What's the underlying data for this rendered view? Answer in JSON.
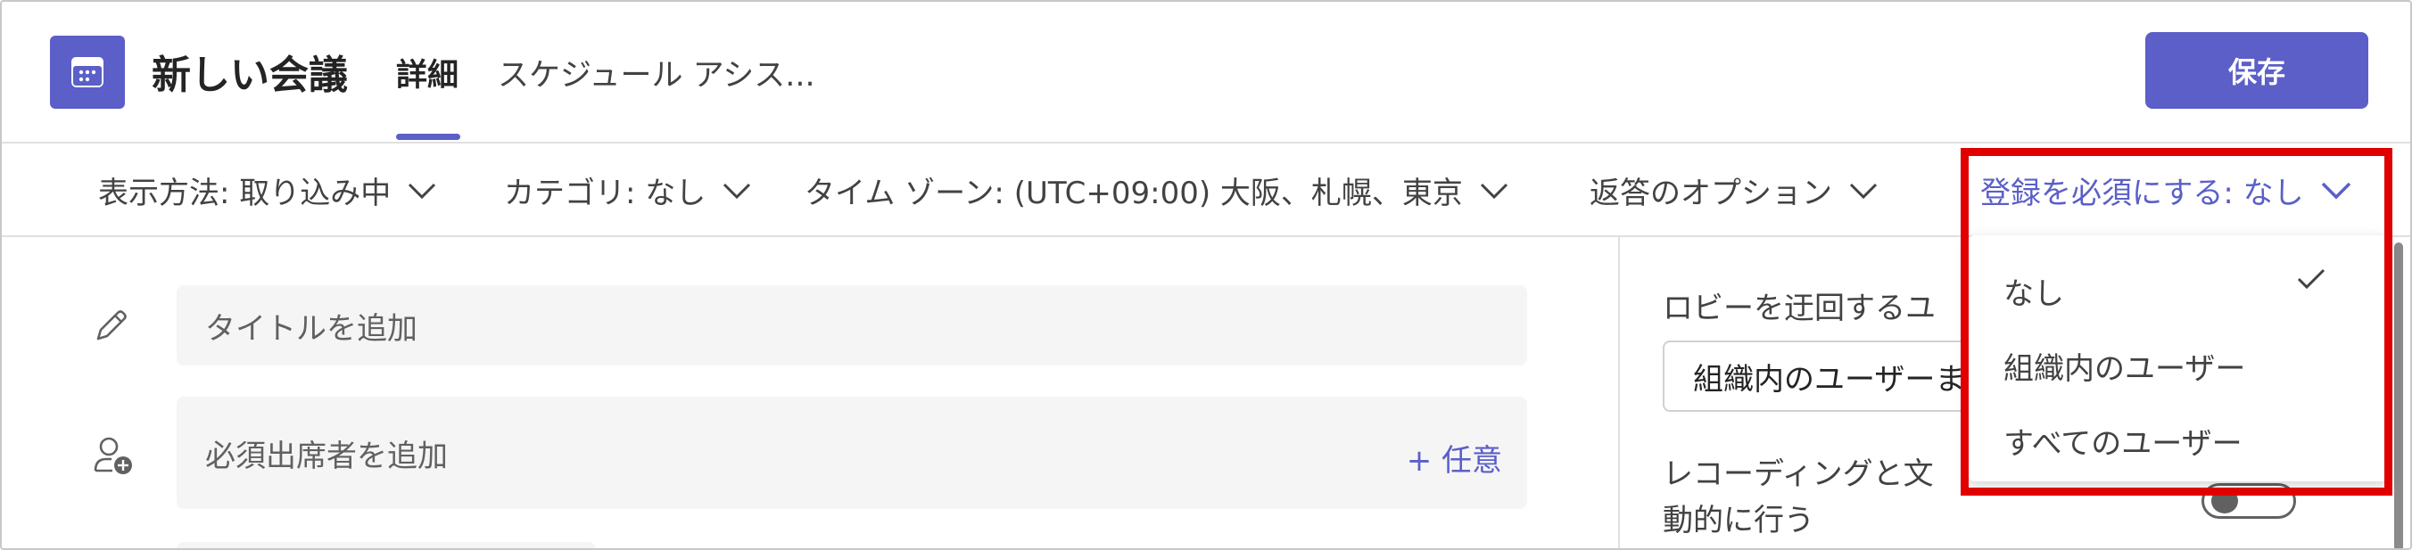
{
  "header": {
    "title": "新しい会議",
    "tabs": [
      {
        "label": "詳細",
        "selected": true
      },
      {
        "label": "スケジュール アシス..."
      }
    ],
    "save_label": "保存"
  },
  "options_bar": {
    "items": [
      {
        "label": "表示方法: 取り込み中"
      },
      {
        "label": "カテゴリ: なし"
      },
      {
        "label": "タイム ゾーン: (UTC+09:00) 大阪、札幌、東京"
      },
      {
        "label": "返答のオプション"
      },
      {
        "label": "登録を必須にする: なし"
      }
    ]
  },
  "form": {
    "title_placeholder": "タイトルを追加",
    "attendees_placeholder": "必須出席者を追加",
    "optional_label": "+ 任意"
  },
  "side_panel": {
    "lobby_label": "ロビーを迂回するユ",
    "lobby_value": "組織内のユーザーま",
    "recording_label_line1": "レコーディングと文",
    "recording_label_line2": "動的に行う"
  },
  "registration_dropdown": {
    "options": [
      {
        "label": "なし",
        "selected": true
      },
      {
        "label": "組織内のユーザー",
        "selected": false
      },
      {
        "label": "すべてのユーザー",
        "selected": false
      }
    ]
  },
  "colors": {
    "accent": "#5b5fc7",
    "highlight": "#e00000"
  }
}
